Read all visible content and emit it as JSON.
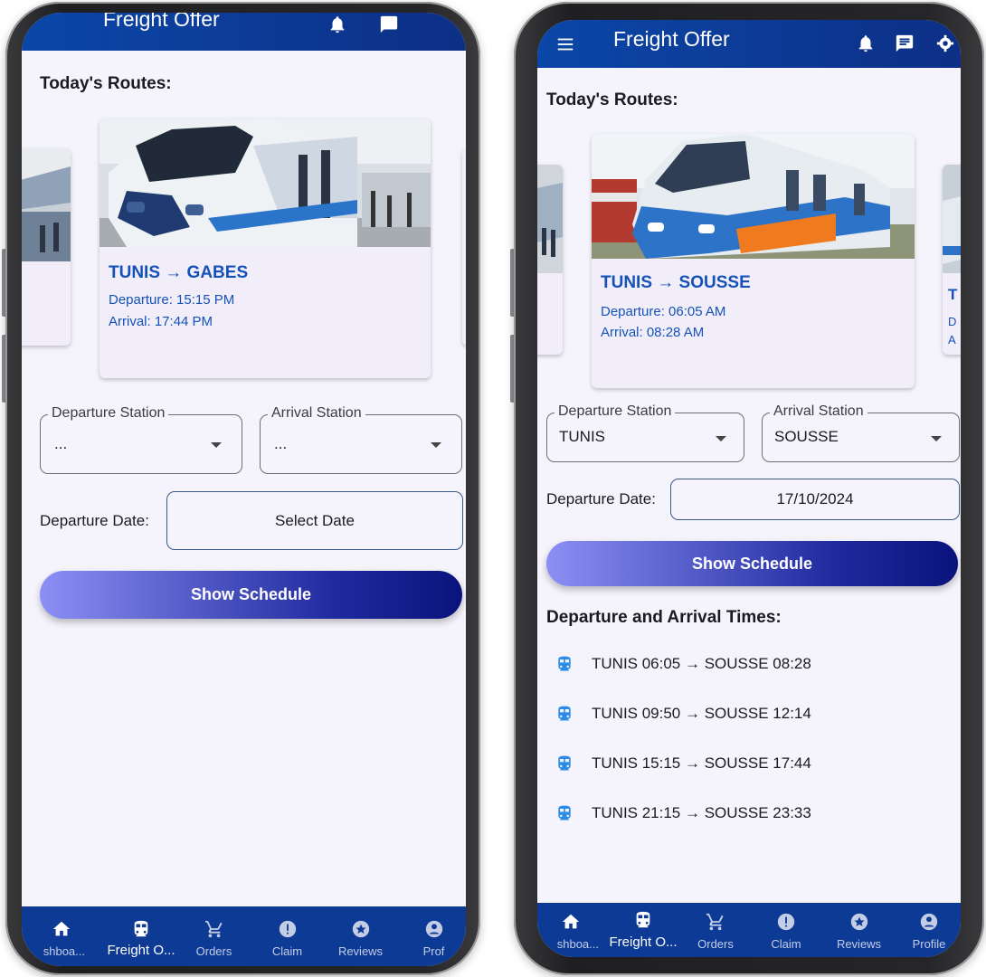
{
  "colors": {
    "app_bar": "#0b47a8",
    "accent": "#1552b8",
    "nav_bar": "#0d3a95",
    "button_start": "#8c8ff4",
    "button_end": "#0a137c"
  },
  "left": {
    "app_title": "Freight Offer",
    "routes_heading": "Today's Routes:",
    "card": {
      "route": "TUNIS → GABES",
      "departure": "Departure: 15:15 PM",
      "arrival": "Arrival: 17:44 PM"
    },
    "departure_station": {
      "label": "Departure Station",
      "value": "..."
    },
    "arrival_station": {
      "label": "Arrival Station",
      "value": "..."
    },
    "date_label": "Departure Date:",
    "date_value": "Select Date",
    "show_button": "Show Schedule"
  },
  "right": {
    "app_title": "Freight Offer",
    "routes_heading": "Today's Routes:",
    "card": {
      "route": "TUNIS → SOUSSE",
      "departure": "Departure: 06:05 AM",
      "arrival": "Arrival: 08:28 AM"
    },
    "peek_card": {
      "route": "T",
      "departure": "D",
      "arrival": "A"
    },
    "departure_station": {
      "label": "Departure Station",
      "value": "TUNIS"
    },
    "arrival_station": {
      "label": "Arrival Station",
      "value": "SOUSSE"
    },
    "date_label": "Departure Date:",
    "date_value": "17/10/2024",
    "show_button": "Show Schedule",
    "times_heading": "Departure and Arrival Times:",
    "schedule": [
      "TUNIS 06:05 → SOUSSE 08:28",
      "TUNIS 09:50 → SOUSSE 12:14",
      "TUNIS 15:15 → SOUSSE 17:44",
      "TUNIS 21:15 → SOUSSE 23:33"
    ]
  },
  "nav": {
    "left": [
      "shboa...",
      "Freight O...",
      "Orders",
      "Claim",
      "Reviews",
      "Prof"
    ],
    "right": [
      "shboa...",
      "Freight O...",
      "Orders",
      "Claim",
      "Reviews",
      "Profile"
    ],
    "icons": [
      "home-icon",
      "train-icon",
      "cart-icon",
      "alert-icon",
      "star-icon",
      "profile-icon"
    ]
  }
}
